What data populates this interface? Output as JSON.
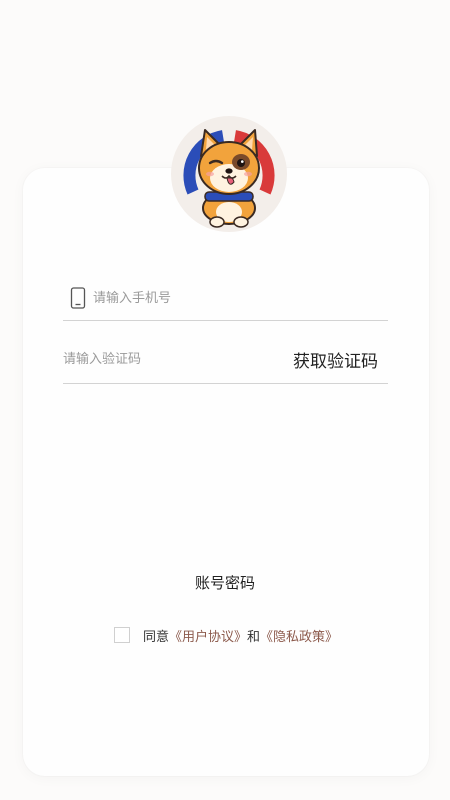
{
  "colors": {
    "background": "#fcfbfa",
    "card": "#fefefe",
    "divider": "#d3d3d3",
    "link": "#8c5a4c",
    "text": "#222222"
  },
  "logo": {
    "icon": "shiba-dog-avatar"
  },
  "login_form": {
    "phone_icon": "mobile-phone-icon",
    "phone_placeholder": "请输入手机号",
    "code_placeholder": "请输入验证码",
    "get_code_label": "获取验证码"
  },
  "account_login_label": "账号密码",
  "agreement": {
    "prefix": "同意",
    "user_agreement": "《用户协议》",
    "conjunction": "和",
    "privacy_policy": "《隐私政策》"
  }
}
